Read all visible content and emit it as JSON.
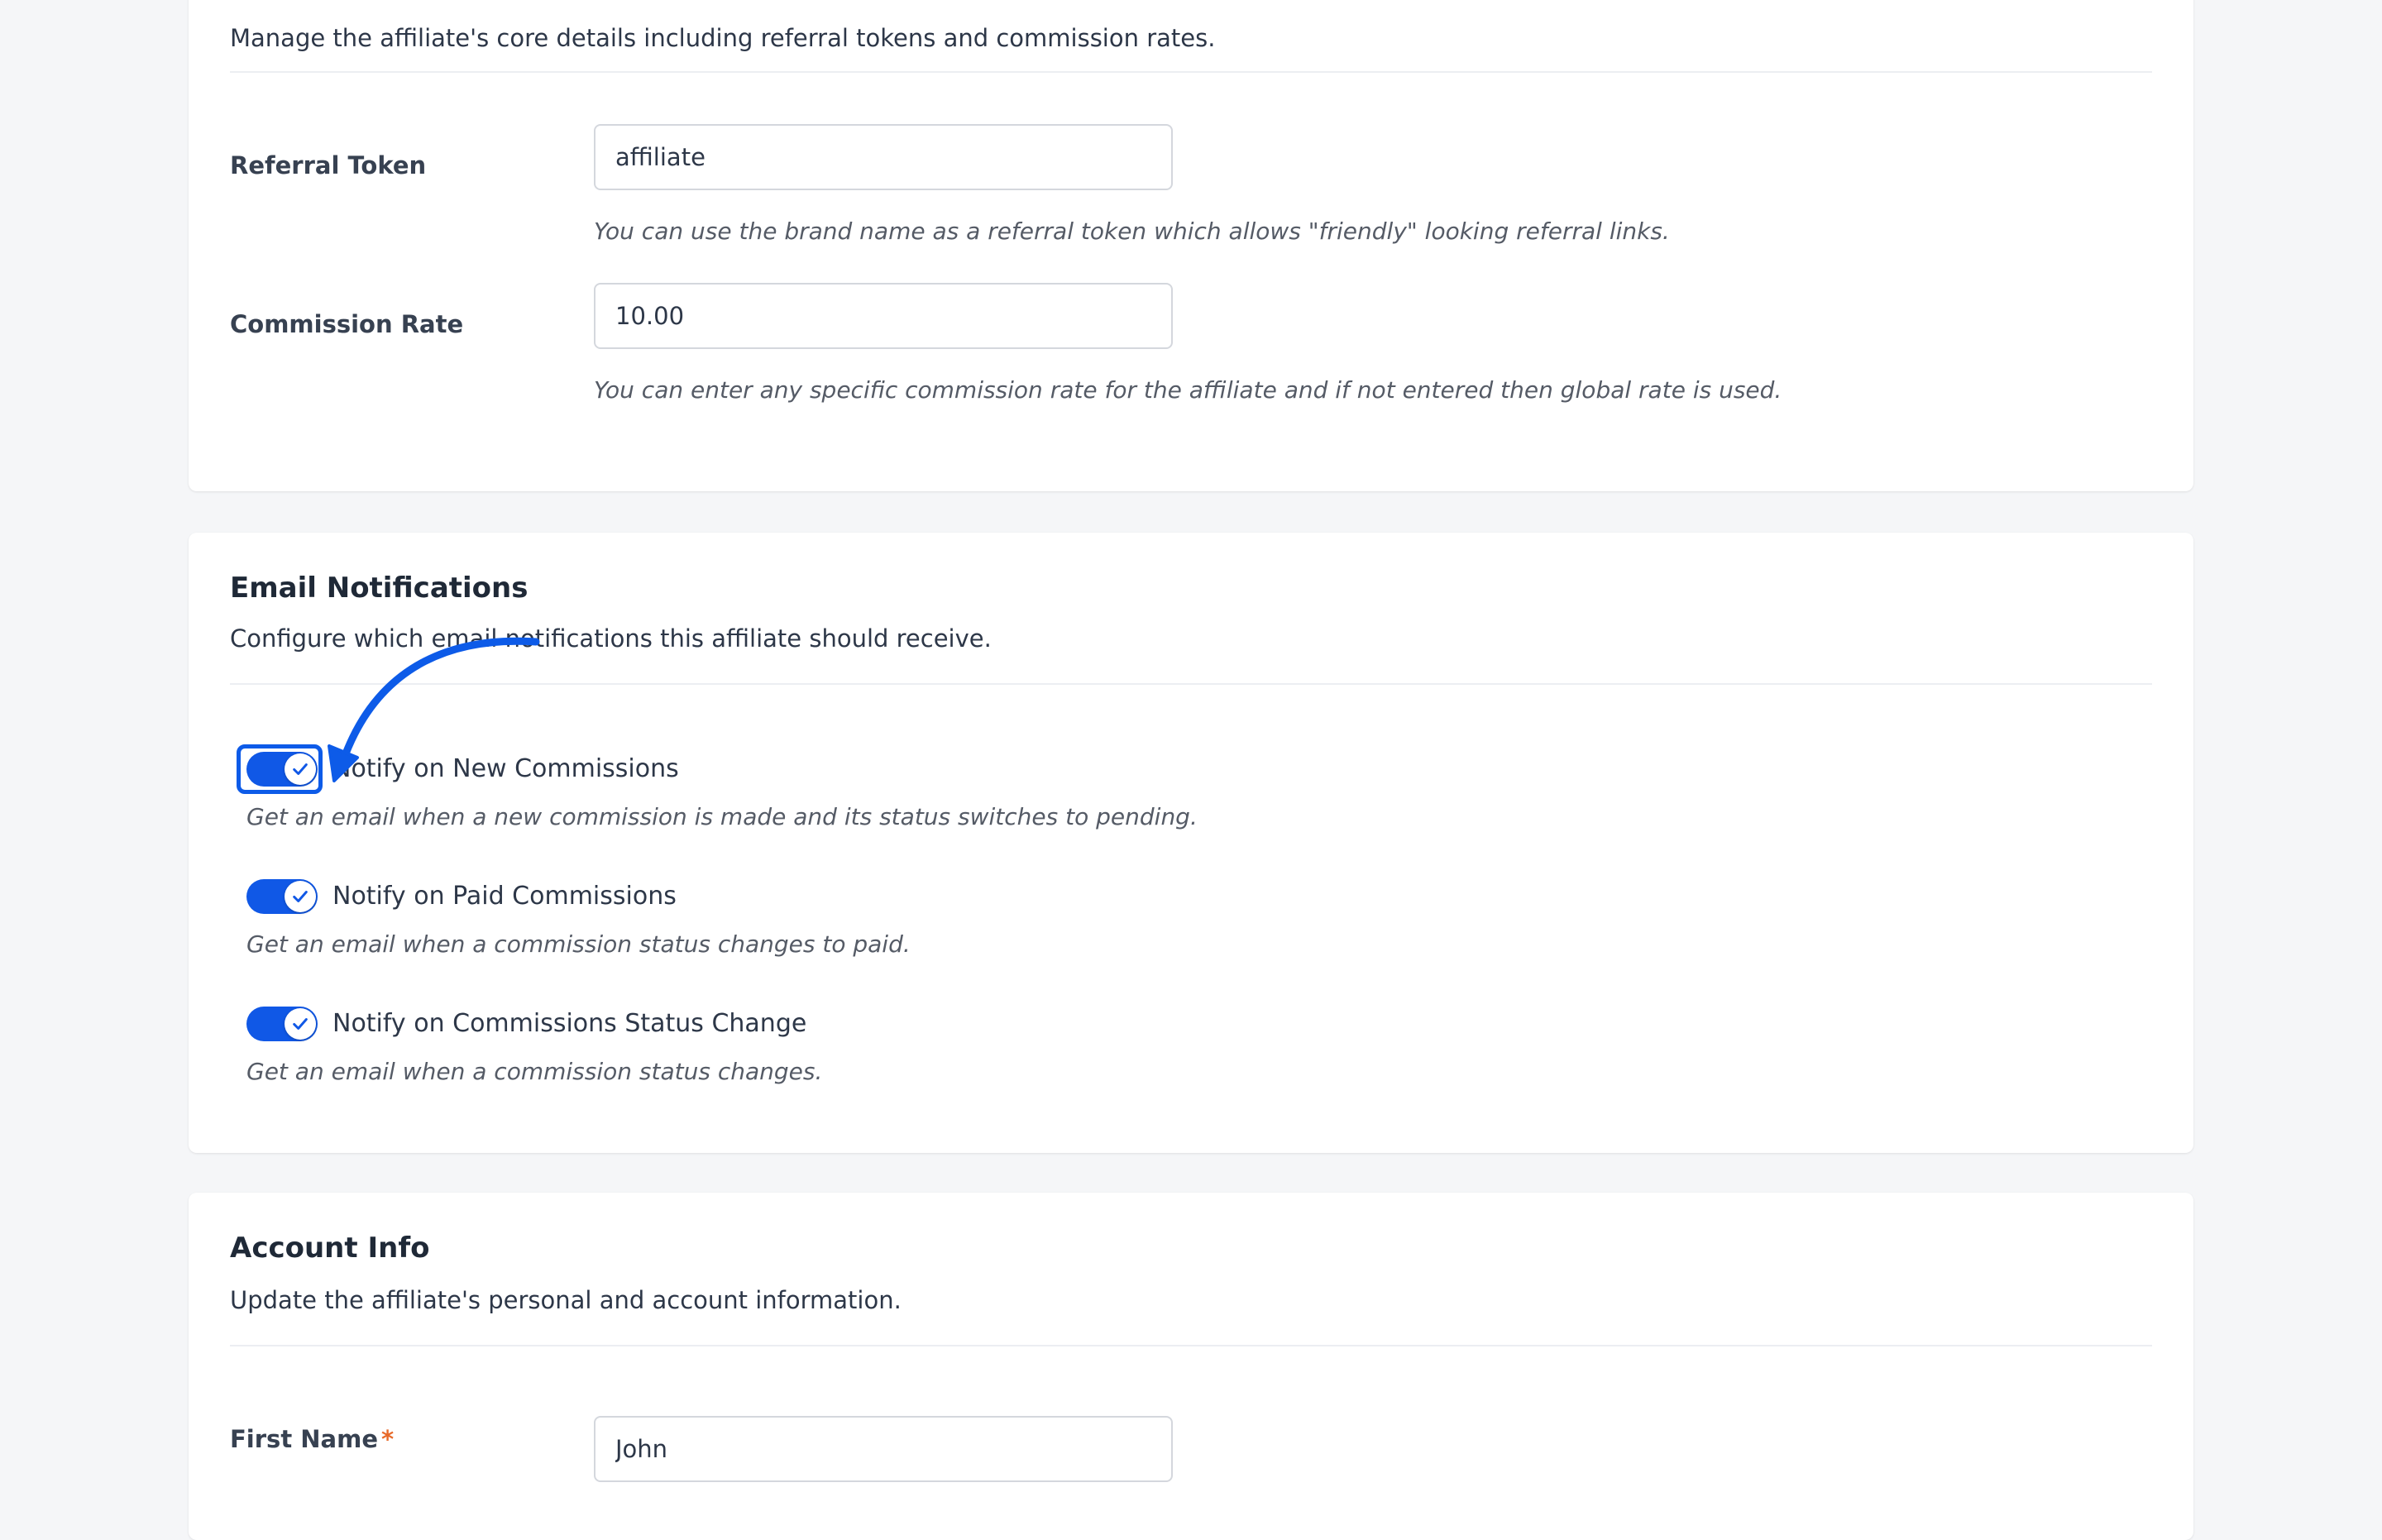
{
  "general": {
    "description": "Manage the affiliate's core details including referral tokens and commission rates.",
    "referral_token": {
      "label": "Referral Token",
      "value": "affiliate",
      "help": "You can use the brand name as a referral token which allows \"friendly\" looking referral links."
    },
    "commission_rate": {
      "label": "Commission Rate",
      "value": "10.00",
      "help": "You can enter any specific commission rate for the affiliate and if not entered then global rate is used."
    }
  },
  "notifications": {
    "title": "Email Notifications",
    "description": "Configure which email notifications this affiliate should receive.",
    "items": [
      {
        "label": "Notify on New Commissions",
        "help": "Get an email when a new commission is made and its status switches to pending.",
        "enabled": true
      },
      {
        "label": "Notify on Paid Commissions",
        "help": "Get an email when a commission status changes to paid.",
        "enabled": true
      },
      {
        "label": "Notify on Commissions Status Change",
        "help": "Get an email when a commission status changes.",
        "enabled": true
      }
    ]
  },
  "account": {
    "title": "Account Info",
    "description": "Update the affiliate's personal and account information.",
    "first_name": {
      "label": "First Name",
      "required_mark": "*",
      "value": "John"
    }
  },
  "colors": {
    "accent": "#1058e6",
    "annotation": "#0d5be8",
    "required": "#e86a2a"
  },
  "icons": {
    "toggle_check": "check-icon",
    "annotation": "curved-arrow-icon"
  }
}
